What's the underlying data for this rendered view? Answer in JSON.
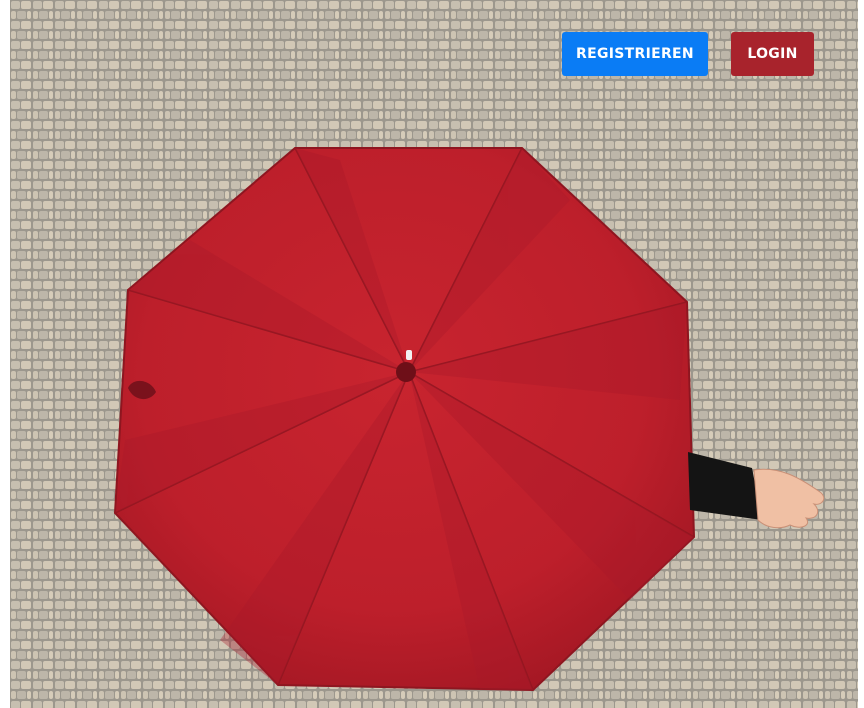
{
  "header": {
    "register_label": "REGISTRIEREN",
    "login_label": "LOGIN"
  },
  "colors": {
    "register_button": "#0a7cf5",
    "login_button": "#a8232c",
    "umbrella": "#c01f2b",
    "wall": "#b8b2a6"
  },
  "hero": {
    "image_subject": "red-umbrella-against-cobblestone-wall"
  }
}
